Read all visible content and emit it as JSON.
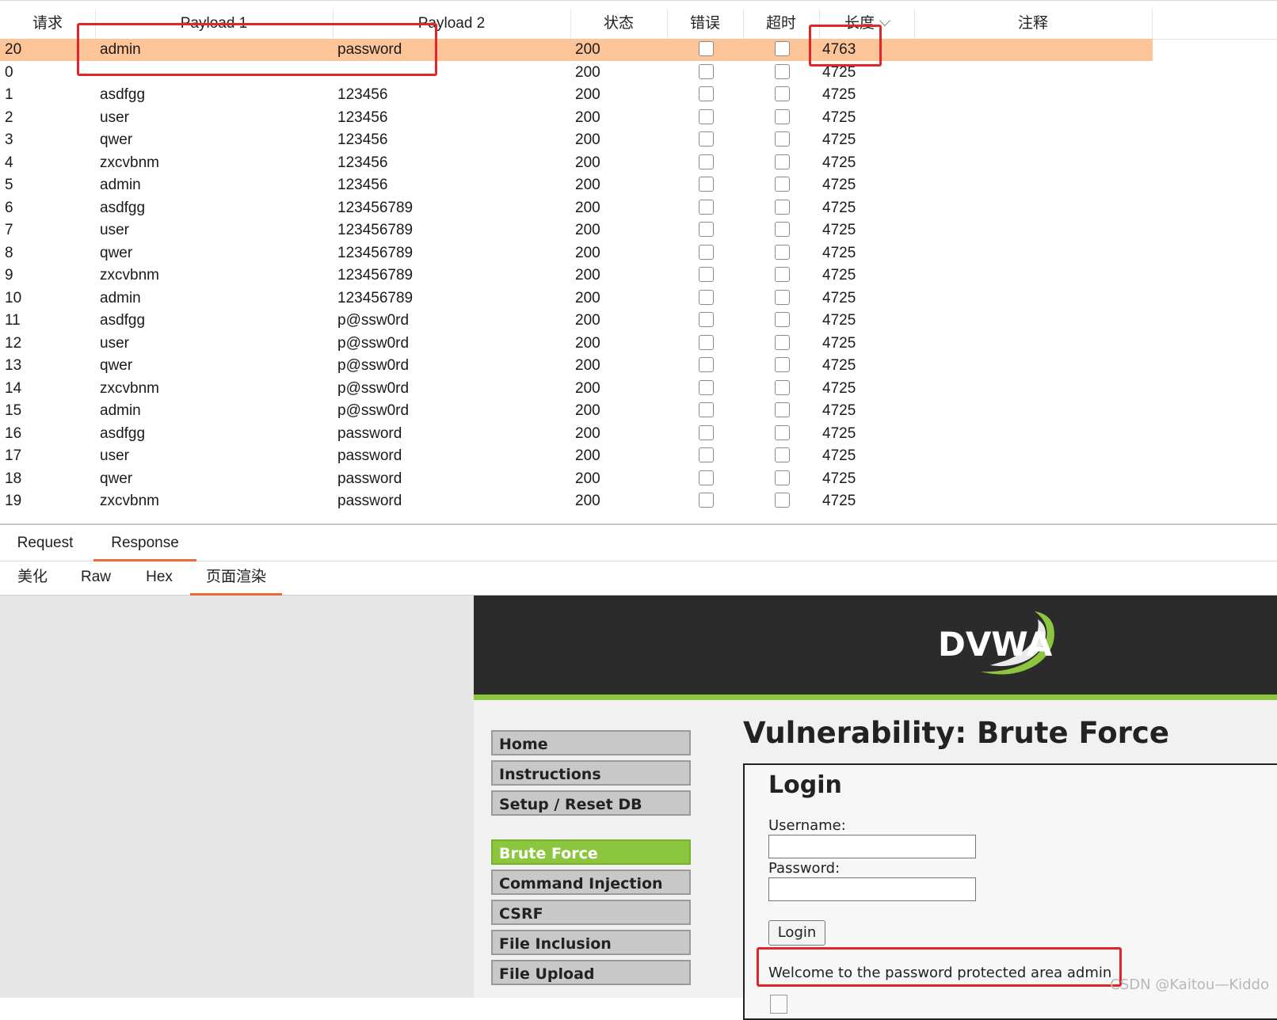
{
  "table": {
    "columns": [
      "请求",
      "Payload 1",
      "Payload 2",
      "状态",
      "错误",
      "超时",
      "长度",
      "注释"
    ],
    "rows": [
      {
        "req": "20",
        "p1": "admin",
        "p2": "password",
        "status": "200",
        "length": "4763",
        "selected": true
      },
      {
        "req": "0",
        "p1": "",
        "p2": "",
        "status": "200",
        "length": "4725"
      },
      {
        "req": "1",
        "p1": "asdfgg",
        "p2": "123456",
        "status": "200",
        "length": "4725"
      },
      {
        "req": "2",
        "p1": "user",
        "p2": "123456",
        "status": "200",
        "length": "4725"
      },
      {
        "req": "3",
        "p1": "qwer",
        "p2": "123456",
        "status": "200",
        "length": "4725"
      },
      {
        "req": "4",
        "p1": "zxcvbnm",
        "p2": "123456",
        "status": "200",
        "length": "4725"
      },
      {
        "req": "5",
        "p1": "admin",
        "p2": "123456",
        "status": "200",
        "length": "4725"
      },
      {
        "req": "6",
        "p1": "asdfgg",
        "p2": "123456789",
        "status": "200",
        "length": "4725"
      },
      {
        "req": "7",
        "p1": "user",
        "p2": "123456789",
        "status": "200",
        "length": "4725"
      },
      {
        "req": "8",
        "p1": "qwer",
        "p2": "123456789",
        "status": "200",
        "length": "4725"
      },
      {
        "req": "9",
        "p1": "zxcvbnm",
        "p2": "123456789",
        "status": "200",
        "length": "4725"
      },
      {
        "req": "10",
        "p1": "admin",
        "p2": "123456789",
        "status": "200",
        "length": "4725"
      },
      {
        "req": "11",
        "p1": "asdfgg",
        "p2": "p@ssw0rd",
        "status": "200",
        "length": "4725"
      },
      {
        "req": "12",
        "p1": "user",
        "p2": "p@ssw0rd",
        "status": "200",
        "length": "4725"
      },
      {
        "req": "13",
        "p1": "qwer",
        "p2": "p@ssw0rd",
        "status": "200",
        "length": "4725"
      },
      {
        "req": "14",
        "p1": "zxcvbnm",
        "p2": "p@ssw0rd",
        "status": "200",
        "length": "4725"
      },
      {
        "req": "15",
        "p1": "admin",
        "p2": "p@ssw0rd",
        "status": "200",
        "length": "4725"
      },
      {
        "req": "16",
        "p1": "asdfgg",
        "p2": "password",
        "status": "200",
        "length": "4725"
      },
      {
        "req": "17",
        "p1": "user",
        "p2": "password",
        "status": "200",
        "length": "4725"
      },
      {
        "req": "18",
        "p1": "qwer",
        "p2": "password",
        "status": "200",
        "length": "4725"
      },
      {
        "req": "19",
        "p1": "zxcvbnm",
        "p2": "password",
        "status": "200",
        "length": "4725"
      }
    ]
  },
  "tabs": {
    "request": "Request",
    "response": "Response"
  },
  "subtabs": {
    "pretty": "美化",
    "raw": "Raw",
    "hex": "Hex",
    "render": "页面渲染"
  },
  "dvwa": {
    "logo_text": "DVWA",
    "nav": [
      "Home",
      "Instructions",
      "Setup / Reset DB",
      "Brute Force",
      "Command Injection",
      "CSRF",
      "File Inclusion",
      "File Upload"
    ],
    "title": "Vulnerability: Brute Force",
    "login_heading": "Login",
    "username_label": "Username:",
    "password_label": "Password:",
    "login_button": "Login",
    "welcome": "Welcome to the password protected area admin"
  },
  "watermark": "CSDN @Kaitou—Kiddo",
  "colors": {
    "selected_row": "#fdc597",
    "highlight_red": "#e0262b",
    "dvwa_green": "#8cc63f",
    "tab_accent": "#e86a3a"
  }
}
